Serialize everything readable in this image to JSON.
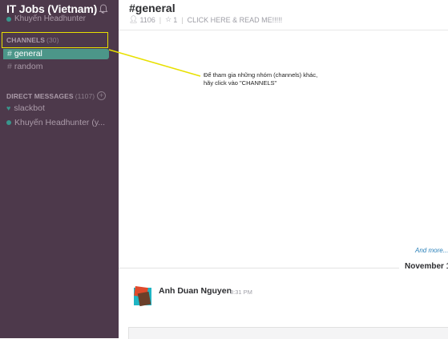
{
  "team": {
    "name": "IT Jobs (Vietnam)",
    "user": "Khuyến Headhunter"
  },
  "channels": {
    "title": "CHANNELS",
    "count": "(30)",
    "items": [
      {
        "label": "general"
      },
      {
        "label": "random"
      }
    ]
  },
  "dms": {
    "title": "DIRECT MESSAGES",
    "count": "(1107)",
    "items": [
      {
        "label": "slackbot"
      },
      {
        "label": "Khuyến Headhunter (y..."
      }
    ]
  },
  "header": {
    "channel": "#general",
    "members": "1106",
    "pinned": "1",
    "topic": "CLICK HERE & READ ME!!!!!"
  },
  "annotation": {
    "line1": "Để tham gia những nhóm (channels) khác,",
    "line2": "hãy click vào \"CHANNELS\""
  },
  "feed": {
    "and_more": "And more...",
    "date": "November 1",
    "message": {
      "author": "Anh Duan Nguyen",
      "time": "8:31 PM"
    }
  },
  "colors": {
    "sidebar": "#4d394b",
    "active": "#4c9689",
    "highlight": "#e8e000",
    "link": "#2a80b9"
  }
}
